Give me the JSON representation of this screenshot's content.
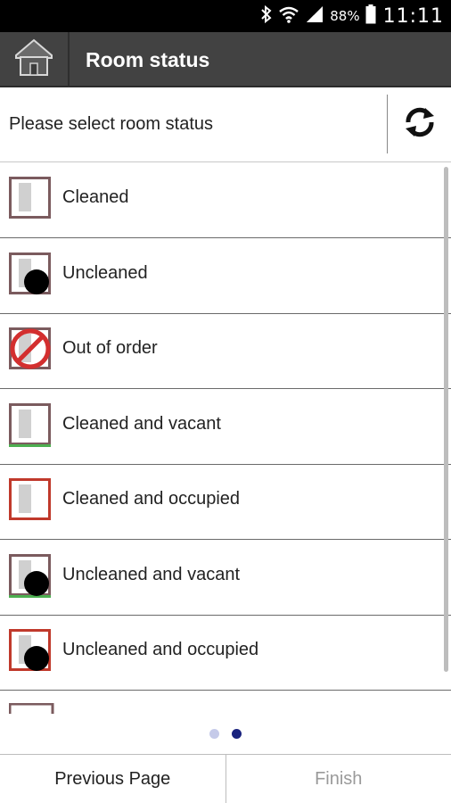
{
  "status_bar": {
    "battery_percent": "88%",
    "time": "11:11"
  },
  "action_bar": {
    "title": "Room status"
  },
  "header": {
    "prompt": "Please select room status"
  },
  "statuses": [
    {
      "label": "Cleaned",
      "icon": "room-cleaned-icon",
      "frame_color": "#7b5b5e",
      "underline": null,
      "dot": false,
      "banned": false
    },
    {
      "label": "Uncleaned",
      "icon": "room-uncleaned-icon",
      "frame_color": "#7b5b5e",
      "underline": null,
      "dot": true,
      "banned": false
    },
    {
      "label": "Out of order",
      "icon": "out-of-order-icon",
      "frame_color": "#7b5b5e",
      "underline": null,
      "dot": false,
      "banned": true
    },
    {
      "label": "Cleaned and vacant",
      "icon": "room-cleaned-vacant-icon",
      "frame_color": "#7b5b5e",
      "underline": "#4caf50",
      "dot": false,
      "banned": false
    },
    {
      "label": "Cleaned and occupied",
      "icon": "room-cleaned-occupied-icon",
      "frame_color": "#c0392b",
      "underline": null,
      "dot": false,
      "banned": false
    },
    {
      "label": "Uncleaned and vacant",
      "icon": "room-uncleaned-vacant-icon",
      "frame_color": "#7b5b5e",
      "underline": "#4caf50",
      "dot": true,
      "banned": false
    },
    {
      "label": "Uncleaned and occupied",
      "icon": "room-uncleaned-occupied-icon",
      "frame_color": "#c0392b",
      "underline": null,
      "dot": true,
      "banned": false
    }
  ],
  "pagination": {
    "pages": 2,
    "current_page": 2,
    "active_color": "#1a237e",
    "inactive_color": "#c5cae9"
  },
  "bottom_bar": {
    "previous_label": "Previous Page",
    "finish_label": "Finish"
  }
}
